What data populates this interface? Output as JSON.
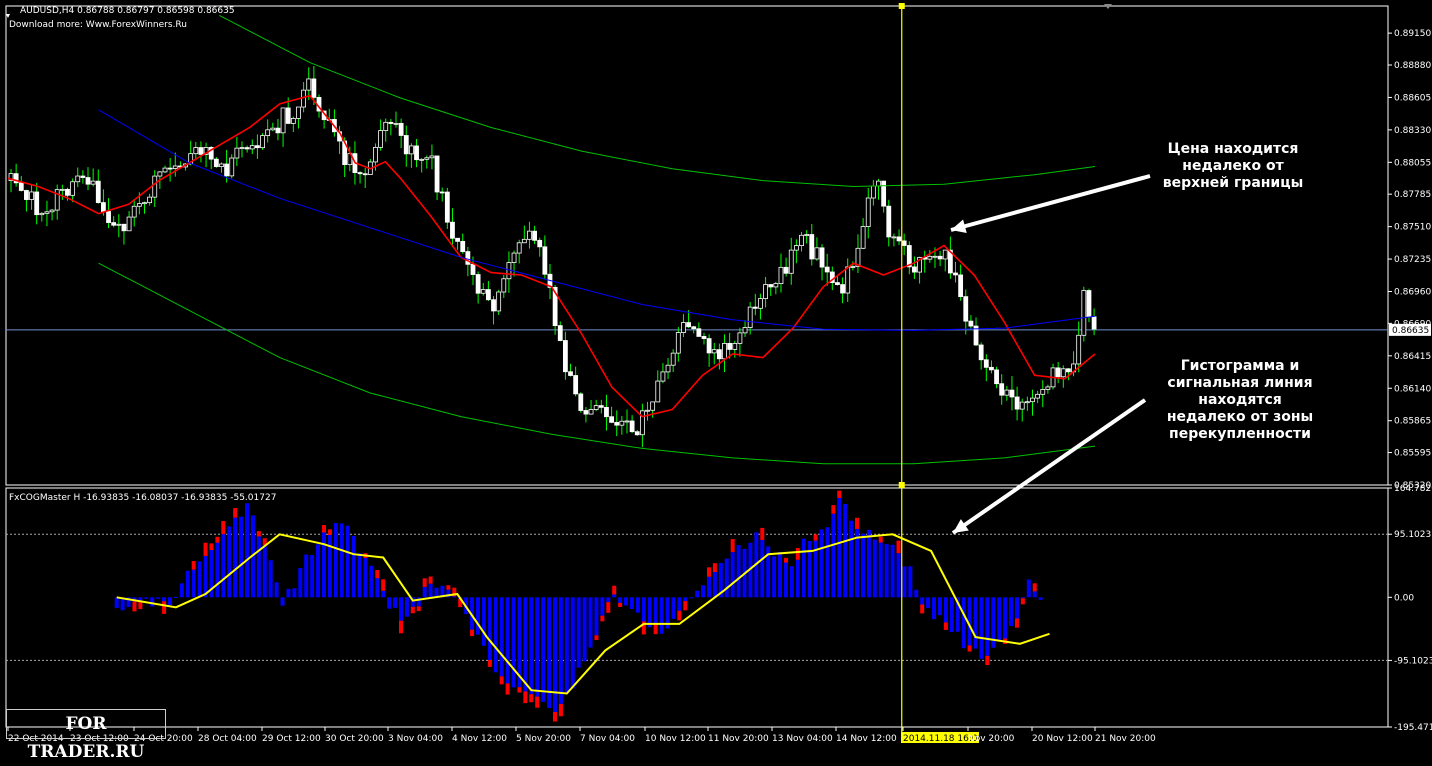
{
  "header": {
    "main": "AUDUSD,H4  0.86788 0.86797 0.86598 0.86635",
    "main_sub": "Download more: Www.ForexWinners.Ru",
    "indicator": "FxCOGMaster H -16.93835 -16.08037 -16.93835 -55.01727"
  },
  "annotations": {
    "top": [
      "Цена находится",
      "недалеко от",
      "верхней границы"
    ],
    "bottom": [
      "Гистограмма и",
      "сигнальная линия",
      "находятся",
      "недалеко от зоны",
      "перекупленности"
    ]
  },
  "watermark": "FOR TRADER.RU",
  "colors": {
    "bull": "#ffffff",
    "bear": "#ffffff",
    "wick": "#00ff00",
    "red_line": "#ff0000",
    "blue_line": "#0000ff",
    "green_channel": "#00c000",
    "current_price": "#6f8fcf",
    "vline": "#ffff00",
    "hist_blue": "#0000ff",
    "hist_red": "#ff0000",
    "signal": "#ffff00",
    "axis_text": "#ffffff",
    "frame": "#ffffff"
  },
  "chart_data": [
    {
      "type": "candlestick",
      "symbol": "AUDUSD,H4",
      "ylim": [
        0.8532,
        0.8938
      ],
      "y_ticks": [
        "0.89150",
        "0.88880",
        "0.88605",
        "0.88330",
        "0.88055",
        "0.87785",
        "0.87510",
        "0.87235",
        "0.86960",
        "0.86690",
        "0.86415",
        "0.86140",
        "0.85865",
        "0.85595",
        "0.85320"
      ],
      "current_price": "0.86635",
      "x_ticks": [
        "22 Oct 2014",
        "23 Oct 12:00",
        "24 Oct 20:00",
        "28 Oct 04:00",
        "29 Oct 12:00",
        "30 Oct 20:00",
        "3 Nov 04:00",
        "4 Nov 12:00",
        "5 Nov 20:00",
        "7 Nov 04:00",
        "10 Nov 12:00",
        "11 Nov 20:00",
        "13 Nov 04:00",
        "14 Nov 12:00",
        "2014.11.18 16:00",
        "Nov 20:00",
        "20 Nov 12:00",
        "21 Nov 20:00"
      ],
      "close_path": [
        [
          0,
          0.879
        ],
        [
          6,
          0.878
        ],
        [
          12,
          0.876
        ],
        [
          18,
          0.878
        ],
        [
          24,
          0.8795
        ],
        [
          30,
          0.878
        ],
        [
          36,
          0.8745
        ],
        [
          42,
          0.877
        ],
        [
          48,
          0.8785
        ],
        [
          54,
          0.88
        ],
        [
          60,
          0.8815
        ],
        [
          66,
          0.881
        ],
        [
          72,
          0.88
        ],
        [
          78,
          0.8815
        ],
        [
          84,
          0.883
        ],
        [
          90,
          0.884
        ],
        [
          96,
          0.8855
        ],
        [
          100,
          0.887
        ],
        [
          104,
          0.885
        ],
        [
          108,
          0.883
        ],
        [
          112,
          0.881
        ],
        [
          116,
          0.879
        ],
        [
          120,
          0.881
        ],
        [
          124,
          0.883
        ],
        [
          128,
          0.884
        ],
        [
          132,
          0.882
        ],
        [
          136,
          0.88
        ],
        [
          140,
          0.881
        ],
        [
          144,
          0.877
        ],
        [
          148,
          0.874
        ],
        [
          152,
          0.872
        ],
        [
          156,
          0.87
        ],
        [
          160,
          0.868
        ],
        [
          164,
          0.871
        ],
        [
          168,
          0.8725
        ],
        [
          172,
          0.874
        ],
        [
          176,
          0.873
        ],
        [
          180,
          0.869
        ],
        [
          184,
          0.864
        ],
        [
          188,
          0.861
        ],
        [
          192,
          0.859
        ],
        [
          196,
          0.86
        ],
        [
          200,
          0.859
        ],
        [
          204,
          0.8585
        ],
        [
          208,
          0.858
        ],
        [
          212,
          0.86
        ],
        [
          216,
          0.8625
        ],
        [
          220,
          0.865
        ],
        [
          224,
          0.868
        ],
        [
          228,
          0.866
        ],
        [
          232,
          0.864
        ],
        [
          236,
          0.8645
        ],
        [
          240,
          0.865
        ],
        [
          244,
          0.867
        ],
        [
          248,
          0.869
        ],
        [
          252,
          0.87
        ],
        [
          256,
          0.871
        ],
        [
          260,
          0.873
        ],
        [
          264,
          0.874
        ],
        [
          268,
          0.8725
        ],
        [
          272,
          0.871
        ],
        [
          276,
          0.87
        ],
        [
          280,
          0.872
        ],
        [
          284,
          0.876
        ],
        [
          288,
          0.879
        ],
        [
          292,
          0.874
        ],
        [
          296,
          0.873
        ],
        [
          300,
          0.872
        ],
        [
          304,
          0.8725
        ],
        [
          308,
          0.873
        ],
        [
          312,
          0.872
        ],
        [
          316,
          0.868
        ],
        [
          320,
          0.865
        ],
        [
          324,
          0.863
        ],
        [
          328,
          0.862
        ],
        [
          332,
          0.86
        ],
        [
          336,
          0.8595
        ],
        [
          340,
          0.86
        ],
        [
          344,
          0.862
        ],
        [
          348,
          0.863
        ],
        [
          352,
          0.8625
        ],
        [
          356,
          0.869
        ],
        [
          360,
          0.867
        ]
      ],
      "series": [
        {
          "name": "",
          "role": "red-ma",
          "points": [
            [
              0,
              0.8792
            ],
            [
              10,
              0.8785
            ],
            [
              20,
              0.8775
            ],
            [
              30,
              0.8762
            ],
            [
              40,
              0.877
            ],
            [
              50,
              0.879
            ],
            [
              60,
              0.8805
            ],
            [
              70,
              0.882
            ],
            [
              80,
              0.8835
            ],
            [
              90,
              0.8855
            ],
            [
              100,
              0.8862
            ],
            [
              110,
              0.883
            ],
            [
              115,
              0.8805
            ],
            [
              120,
              0.88
            ],
            [
              125,
              0.8806
            ],
            [
              130,
              0.8792
            ],
            [
              140,
              0.876
            ],
            [
              150,
              0.8725
            ],
            [
              160,
              0.8712
            ],
            [
              170,
              0.871
            ],
            [
              180,
              0.87
            ],
            [
              190,
              0.866
            ],
            [
              200,
              0.8615
            ],
            [
              210,
              0.859
            ],
            [
              220,
              0.8596
            ],
            [
              230,
              0.8625
            ],
            [
              240,
              0.8643
            ],
            [
              250,
              0.864
            ],
            [
              260,
              0.8665
            ],
            [
              270,
              0.87
            ],
            [
              280,
              0.872
            ],
            [
              290,
              0.871
            ],
            [
              300,
              0.872
            ],
            [
              310,
              0.8735
            ],
            [
              320,
              0.871
            ],
            [
              330,
              0.867
            ],
            [
              340,
              0.8625
            ],
            [
              350,
              0.8622
            ],
            [
              360,
              0.8643
            ]
          ]
        },
        {
          "name": "",
          "role": "blue-regression",
          "points": [
            [
              30,
              0.885
            ],
            [
              60,
              0.8805
            ],
            [
              90,
              0.8775
            ],
            [
              120,
              0.875
            ],
            [
              150,
              0.8725
            ],
            [
              180,
              0.8705
            ],
            [
              210,
              0.8685
            ],
            [
              240,
              0.8672
            ],
            [
              270,
              0.8664
            ],
            [
              300,
              0.8663
            ],
            [
              330,
              0.8665
            ],
            [
              360,
              0.8675
            ]
          ]
        },
        {
          "name": "",
          "role": "green-upper",
          "points": [
            [
              70,
              0.893
            ],
            [
              100,
              0.889
            ],
            [
              130,
              0.886
            ],
            [
              160,
              0.8835
            ],
            [
              190,
              0.8815
            ],
            [
              220,
              0.88
            ],
            [
              250,
              0.879
            ],
            [
              280,
              0.8785
            ],
            [
              310,
              0.8787
            ],
            [
              340,
              0.8795
            ],
            [
              360,
              0.8802
            ]
          ]
        },
        {
          "name": "",
          "role": "green-lower",
          "points": [
            [
              30,
              0.872
            ],
            [
              60,
              0.868
            ],
            [
              90,
              0.864
            ],
            [
              120,
              0.861
            ],
            [
              150,
              0.859
            ],
            [
              180,
              0.8575
            ],
            [
              210,
              0.8563
            ],
            [
              240,
              0.8555
            ],
            [
              270,
              0.855
            ],
            [
              300,
              0.855
            ],
            [
              330,
              0.8555
            ],
            [
              360,
              0.8565
            ]
          ]
        }
      ]
    },
    {
      "type": "bar",
      "name": "FxCOGMaster H",
      "ylim": [
        -195.4718,
        164.782
      ],
      "y_ticks": [
        "164.78200",
        "95.1023",
        "0.00",
        "-95.1023",
        "-195.4718"
      ],
      "levels": [
        95.1023,
        -95.1023
      ],
      "hist_path": [
        [
          0,
          -20
        ],
        [
          10,
          -10
        ],
        [
          18,
          -5
        ],
        [
          22,
          20
        ],
        [
          28,
          60
        ],
        [
          32,
          80
        ],
        [
          36,
          100
        ],
        [
          40,
          120
        ],
        [
          44,
          140
        ],
        [
          48,
          100
        ],
        [
          52,
          60
        ],
        [
          56,
          -10
        ],
        [
          60,
          20
        ],
        [
          64,
          60
        ],
        [
          68,
          80
        ],
        [
          72,
          100
        ],
        [
          76,
          110
        ],
        [
          80,
          90
        ],
        [
          84,
          60
        ],
        [
          88,
          20
        ],
        [
          92,
          -10
        ],
        [
          96,
          -30
        ],
        [
          100,
          -20
        ],
        [
          104,
          10
        ],
        [
          108,
          20
        ],
        [
          112,
          5
        ],
        [
          116,
          -10
        ],
        [
          120,
          -40
        ],
        [
          124,
          -80
        ],
        [
          128,
          -110
        ],
        [
          132,
          -130
        ],
        [
          136,
          -140
        ],
        [
          140,
          -150
        ],
        [
          144,
          -160
        ],
        [
          148,
          -170
        ],
        [
          152,
          -150
        ],
        [
          156,
          -110
        ],
        [
          160,
          -70
        ],
        [
          164,
          -30
        ],
        [
          168,
          5
        ],
        [
          172,
          -10
        ],
        [
          176,
          -30
        ],
        [
          180,
          -40
        ],
        [
          184,
          -50
        ],
        [
          188,
          -30
        ],
        [
          192,
          -10
        ],
        [
          196,
          10
        ],
        [
          200,
          30
        ],
        [
          204,
          50
        ],
        [
          208,
          70
        ],
        [
          212,
          80
        ],
        [
          216,
          90
        ],
        [
          220,
          80
        ],
        [
          224,
          60
        ],
        [
          228,
          50
        ],
        [
          232,
          80
        ],
        [
          236,
          90
        ],
        [
          240,
          110
        ],
        [
          244,
          150
        ],
        [
          248,
          120
        ],
        [
          252,
          100
        ],
        [
          256,
          90
        ],
        [
          260,
          80
        ],
        [
          264,
          70
        ],
        [
          268,
          40
        ],
        [
          272,
          -10
        ],
        [
          276,
          -30
        ],
        [
          280,
          -40
        ],
        [
          284,
          -60
        ],
        [
          288,
          -80
        ],
        [
          292,
          -90
        ],
        [
          296,
          -80
        ],
        [
          300,
          -60
        ],
        [
          304,
          -40
        ],
        [
          308,
          20
        ],
        [
          312,
          -10
        ]
      ],
      "series": [
        {
          "name": "",
          "role": "signal",
          "points": [
            [
              0,
              0
            ],
            [
              20,
              -15
            ],
            [
              30,
              5
            ],
            [
              45,
              60
            ],
            [
              55,
              95
            ],
            [
              70,
              80
            ],
            [
              80,
              65
            ],
            [
              90,
              60
            ],
            [
              100,
              -5
            ],
            [
              115,
              5
            ],
            [
              125,
              -60
            ],
            [
              140,
              -140
            ],
            [
              152,
              -145
            ],
            [
              165,
              -80
            ],
            [
              178,
              -40
            ],
            [
              190,
              -40
            ],
            [
              205,
              10
            ],
            [
              220,
              65
            ],
            [
              235,
              70
            ],
            [
              250,
              90
            ],
            [
              262,
              95
            ],
            [
              275,
              70
            ],
            [
              290,
              -60
            ],
            [
              305,
              -70
            ],
            [
              315,
              -55
            ]
          ]
        }
      ]
    }
  ]
}
